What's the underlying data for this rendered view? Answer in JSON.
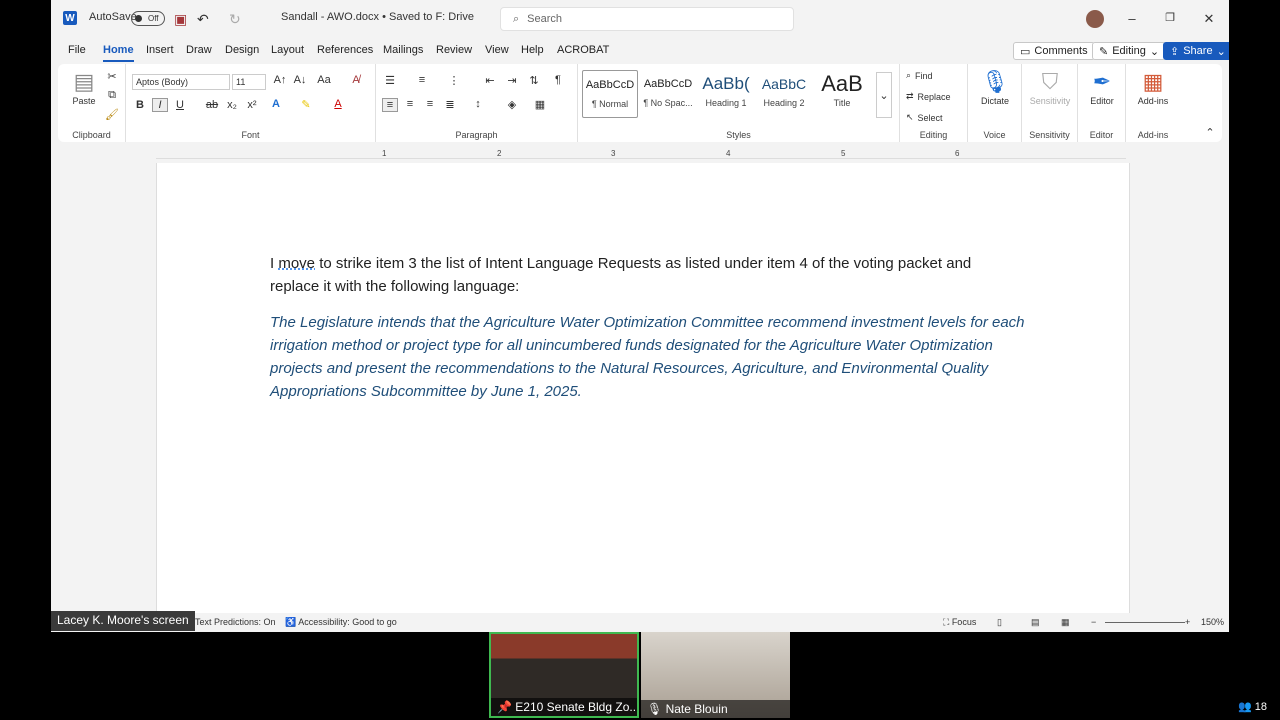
{
  "titlebar": {
    "autosave": "AutoSave",
    "toggle": "Off",
    "doc": "Sandall - AWO.docx • Saved to F: Drive",
    "search_placeholder": "Search"
  },
  "menu": {
    "tabs": [
      "File",
      "Home",
      "Insert",
      "Draw",
      "Design",
      "Layout",
      "References",
      "Mailings",
      "Review",
      "View",
      "Help",
      "ACROBAT"
    ],
    "comments": "Comments",
    "editing": "Editing",
    "share": "Share"
  },
  "ribbon": {
    "clipboard": {
      "label": "Clipboard",
      "paste": "Paste"
    },
    "font": {
      "label": "Font",
      "name": "Aptos (Body)",
      "size": "11"
    },
    "paragraph": {
      "label": "Paragraph"
    },
    "styles": {
      "label": "Styles",
      "items": [
        {
          "preview": "AaBbCcD",
          "name": "¶ Normal"
        },
        {
          "preview": "AaBbCcD",
          "name": "¶ No Spac..."
        },
        {
          "preview": "AaBb(",
          "name": "Heading 1"
        },
        {
          "preview": "AaBbC",
          "name": "Heading 2"
        },
        {
          "preview": "AaB",
          "name": "Title"
        }
      ]
    },
    "editing": {
      "label": "Editing",
      "find": "Find",
      "replace": "Replace",
      "select": "Select"
    },
    "voice": {
      "label": "Voice",
      "dictate": "Dictate"
    },
    "sensitivity": {
      "label": "Sensitivity",
      "btn": "Sensitivity"
    },
    "editor": {
      "label": "Editor",
      "btn": "Editor"
    },
    "addins": {
      "label": "Add-ins",
      "btn": "Add-ins"
    }
  },
  "ruler": [
    "1",
    "2",
    "3",
    "4",
    "5",
    "6"
  ],
  "document": {
    "p1_a": "I ",
    "p1_move": "move",
    "p1_b": " to strike item 3 the list of Intent Language Requests as listed under item 4 of the voting packet and replace it with the following language:",
    "p2": "The Legislature intends that the Agriculture Water Optimization Committee recommend investment levels for each irrigation method or project type for all unincumbered funds designated for the Agriculture Water Optimization projects and present the recommendations to the Natural Resources, Agriculture, and Environmental Quality Appropriations Subcommittee by June 1, 2025."
  },
  "status": {
    "predictions": "Text Predictions: On",
    "accessibility": "Accessibility: Good to go",
    "focus": "Focus",
    "zoom": "150%"
  },
  "share_label": "Lacey K. Moore's screen",
  "videos": [
    {
      "name": "E210 Senate Bldg Zo..."
    },
    {
      "name": "Nate Blouin"
    }
  ],
  "participants": "18"
}
